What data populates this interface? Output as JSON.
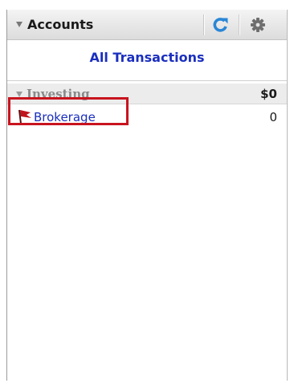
{
  "header": {
    "title": "Accounts",
    "refresh_icon": "refresh-icon",
    "settings_icon": "gear-icon"
  },
  "all_transactions_label": "All Transactions",
  "groups": [
    {
      "name": "Investing",
      "total": "$0",
      "accounts": [
        {
          "name": "Brokerage",
          "balance": "0",
          "icon": "flag-icon",
          "highlighted": true
        }
      ]
    }
  ],
  "colors": {
    "link": "#1b2fbf",
    "refresh": "#2a86d6",
    "flag": "#c0141c",
    "highlight": "#c8141e"
  }
}
